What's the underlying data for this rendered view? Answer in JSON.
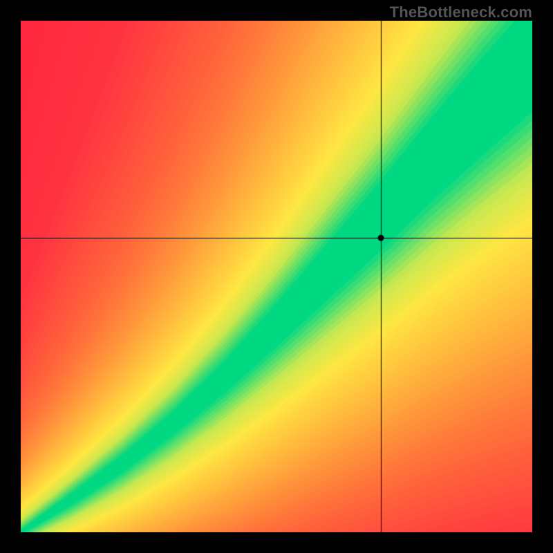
{
  "watermark": "TheBottleneck.com",
  "chart_data": {
    "type": "heatmap",
    "title": "",
    "xlabel": "",
    "ylabel": "",
    "xlim": [
      0,
      1
    ],
    "ylim": [
      0,
      1
    ],
    "crosshair": {
      "x": 0.705,
      "y": 0.575
    },
    "optimal_band": {
      "description": "green band of compatible pairings; approximately y ≈ x^1.25 with half-width growing along x",
      "curve_points": [
        {
          "x": 0.0,
          "y_center": 0.0,
          "half_width": 0.003
        },
        {
          "x": 0.1,
          "y_center": 0.065,
          "half_width": 0.01
        },
        {
          "x": 0.2,
          "y_center": 0.135,
          "half_width": 0.015
        },
        {
          "x": 0.3,
          "y_center": 0.215,
          "half_width": 0.02
        },
        {
          "x": 0.4,
          "y_center": 0.305,
          "half_width": 0.028
        },
        {
          "x": 0.5,
          "y_center": 0.405,
          "half_width": 0.038
        },
        {
          "x": 0.6,
          "y_center": 0.51,
          "half_width": 0.05
        },
        {
          "x": 0.7,
          "y_center": 0.615,
          "half_width": 0.062
        },
        {
          "x": 0.8,
          "y_center": 0.725,
          "half_width": 0.075
        },
        {
          "x": 0.9,
          "y_center": 0.83,
          "half_width": 0.088
        },
        {
          "x": 1.0,
          "y_center": 0.93,
          "half_width": 0.1
        }
      ]
    },
    "color_scale": {
      "description": "distance-from-optimum mapped through green→yellow→orange→red",
      "stops": [
        {
          "d": 0.0,
          "color": "#00D882"
        },
        {
          "d": 0.12,
          "color": "#C8E850"
        },
        {
          "d": 0.22,
          "color": "#FFE742"
        },
        {
          "d": 0.4,
          "color": "#FFB23C"
        },
        {
          "d": 0.62,
          "color": "#FF6E3A"
        },
        {
          "d": 0.85,
          "color": "#FF3340"
        },
        {
          "d": 1.0,
          "color": "#FF2840"
        }
      ]
    },
    "grid": false,
    "legend": false
  }
}
